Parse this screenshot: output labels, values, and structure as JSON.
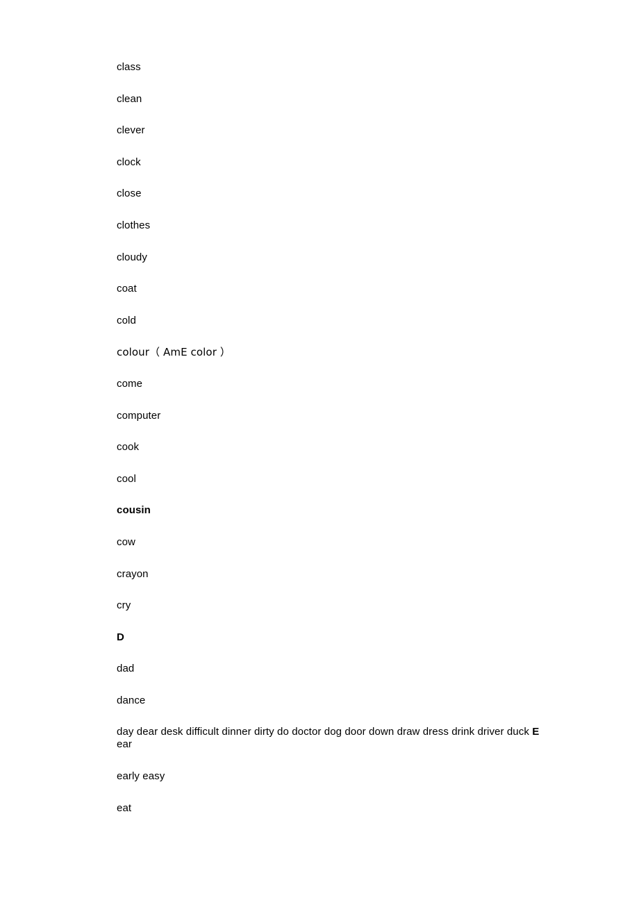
{
  "document": {
    "type": "vocabulary-word-list",
    "page_background": "#ffffff",
    "text_color": "#000000",
    "entries": [
      {
        "id": "class",
        "text": "class",
        "bold": false
      },
      {
        "id": "clean",
        "text": "clean",
        "bold": false
      },
      {
        "id": "clever",
        "text": "clever",
        "bold": false
      },
      {
        "id": "clock",
        "text": "clock",
        "bold": false
      },
      {
        "id": "close",
        "text": "close",
        "bold": false
      },
      {
        "id": "clothes",
        "text": "clothes",
        "bold": false
      },
      {
        "id": "cloudy",
        "text": "cloudy",
        "bold": false
      },
      {
        "id": "coat",
        "text": "coat",
        "bold": false
      },
      {
        "id": "cold",
        "text": "cold",
        "bold": false
      },
      {
        "id": "colour",
        "text": "colour（ AmE color ）",
        "bold": false
      },
      {
        "id": "come",
        "text": "come",
        "bold": false
      },
      {
        "id": "computer",
        "text": "computer",
        "bold": false
      },
      {
        "id": "cook",
        "text": "cook",
        "bold": false
      },
      {
        "id": "cool",
        "text": "cool",
        "bold": false
      },
      {
        "id": "cousin",
        "text": "cousin",
        "bold": true
      },
      {
        "id": "cow",
        "text": "cow",
        "bold": false
      },
      {
        "id": "crayon",
        "text": "crayon",
        "bold": false
      },
      {
        "id": "cry",
        "text": "cry",
        "bold": false
      },
      {
        "id": "heading-d",
        "text": "D",
        "bold": true
      },
      {
        "id": "dad",
        "text": "dad",
        "bold": false
      },
      {
        "id": "dance",
        "text": "dance",
        "bold": false
      }
    ],
    "run_on_line": {
      "id": "d-run-on",
      "segments": [
        {
          "text": "day dear desk difficult dinner dirty do doctor dog door down draw dress drink driver duck ",
          "bold": false
        },
        {
          "text": "E",
          "bold": true
        },
        {
          "text": " ear",
          "bold": false
        }
      ],
      "plain_text": "day dear desk difficult dinner dirty do doctor dog door down draw dress drink driver duck E ear"
    },
    "trailing_entries": [
      {
        "id": "early-easy",
        "text": "early easy",
        "bold": false
      },
      {
        "id": "eat",
        "text": "eat",
        "bold": false
      }
    ]
  }
}
